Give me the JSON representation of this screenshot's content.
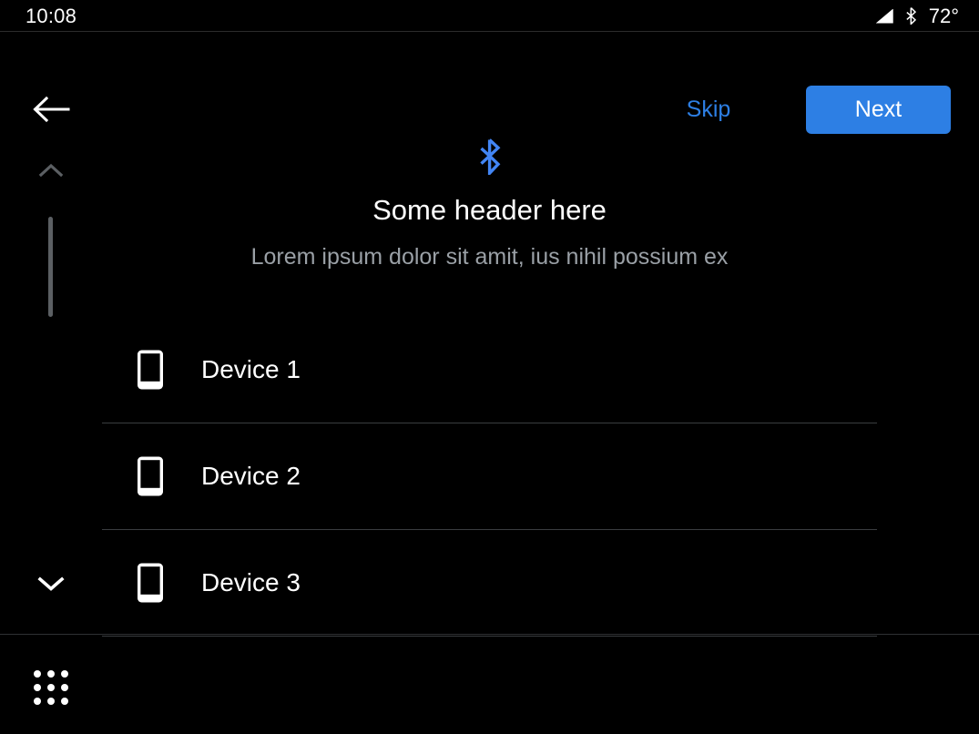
{
  "status_bar": {
    "clock": "10:08",
    "temperature": "72°",
    "signal_icon": "signal-triangle-icon",
    "bluetooth_icon": "bluetooth-icon"
  },
  "action_bar": {
    "back_icon": "back-arrow-icon",
    "skip_label": "Skip",
    "next_label": "Next",
    "accent_color": "#2d7fe4"
  },
  "scroll": {
    "up_icon": "chevron-up-icon",
    "down_icon": "chevron-down-icon",
    "thumb_color": "#5b5f63"
  },
  "content": {
    "hero_icon": "bluetooth-icon",
    "hero_icon_color": "#4285f4",
    "title": "Some header here",
    "subtitle": "Lorem ipsum dolor sit amit, ius nihil possium ex",
    "subtitle_color": "#9aa0a6",
    "devices": [
      {
        "name": "Device 1",
        "icon": "smartphone-icon"
      },
      {
        "name": "Device 2",
        "icon": "smartphone-icon"
      },
      {
        "name": "Device 3",
        "icon": "smartphone-icon"
      }
    ]
  },
  "bottom_bar": {
    "app_grid_icon": "apps-grid-icon"
  }
}
